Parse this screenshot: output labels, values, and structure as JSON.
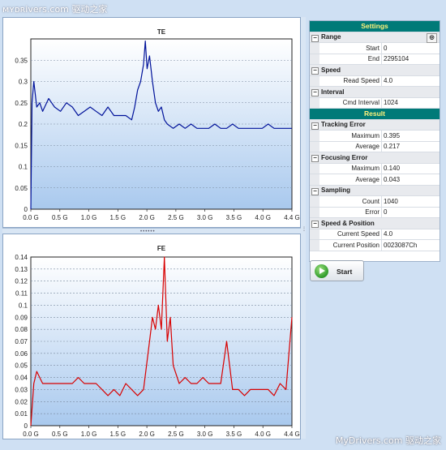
{
  "watermark": {
    "top": "ᴍʏᴅʀivers.com 驱动之家",
    "bottom": "MyDrivers.com 驱动之家"
  },
  "colors": {
    "te_line": "#00129a",
    "fe_line": "#d80000",
    "header": "#007a78",
    "header_text": "#fff27a"
  },
  "settings": {
    "title": "Settings",
    "range": {
      "label": "Range",
      "start_label": "Start",
      "start": "0",
      "end_label": "End",
      "end": "2295104"
    },
    "speed": {
      "label": "Speed",
      "read_speed_label": "Read Speed",
      "read_speed": "4.0"
    },
    "interval": {
      "label": "Interval",
      "cmd_label": "Cmd Interval",
      "cmd": "1024"
    }
  },
  "result": {
    "title": "Result",
    "tracking": {
      "label": "Tracking Error",
      "max_label": "Maximum",
      "max": "0.395",
      "avg_label": "Average",
      "avg": "0.217"
    },
    "focusing": {
      "label": "Focusing Error",
      "max_label": "Maximum",
      "max": "0.140",
      "avg_label": "Average",
      "avg": "0.043"
    },
    "sampling": {
      "label": "Sampling",
      "count_label": "Count",
      "count": "1040",
      "error_label": "Error",
      "error": "0"
    },
    "speed_position": {
      "label": "Speed & Position",
      "cur_speed_label": "Current Speed",
      "cur_speed": "4.0",
      "cur_pos_label": "Current Position",
      "cur_pos": "0023087Ch"
    }
  },
  "start_button": {
    "label": "Start"
  },
  "chart_data": [
    {
      "type": "line",
      "title": "TE",
      "xlabel": "",
      "ylabel": "",
      "xlim": [
        0,
        4.4
      ],
      "ylim": [
        0,
        0.4
      ],
      "x_ticks": [
        "0.0 G",
        "0.5 G",
        "1.0 G",
        "1.5 G",
        "2.0 G",
        "2.5 G",
        "3.0 G",
        "3.5 G",
        "4.0 G",
        "4.4 G"
      ],
      "y_ticks": [
        "0",
        "0.05",
        "0.1",
        "0.15",
        "0.2",
        "0.25",
        "0.3",
        "0.35"
      ],
      "x": [
        0,
        0.02,
        0.05,
        0.1,
        0.15,
        0.2,
        0.3,
        0.4,
        0.5,
        0.6,
        0.7,
        0.8,
        0.9,
        1.0,
        1.1,
        1.2,
        1.3,
        1.4,
        1.5,
        1.6,
        1.7,
        1.75,
        1.8,
        1.85,
        1.9,
        1.93,
        1.96,
        2.0,
        2.05,
        2.1,
        2.15,
        2.2,
        2.25,
        2.3,
        2.4,
        2.5,
        2.6,
        2.7,
        2.8,
        2.9,
        3.0,
        3.1,
        3.2,
        3.3,
        3.4,
        3.5,
        3.6,
        3.7,
        3.8,
        3.9,
        4.0,
        4.1,
        4.2,
        4.3,
        4.4
      ],
      "y": [
        0.0,
        0.25,
        0.3,
        0.24,
        0.25,
        0.23,
        0.26,
        0.24,
        0.23,
        0.25,
        0.24,
        0.22,
        0.23,
        0.24,
        0.23,
        0.22,
        0.24,
        0.22,
        0.22,
        0.22,
        0.21,
        0.24,
        0.28,
        0.3,
        0.34,
        0.395,
        0.33,
        0.36,
        0.3,
        0.25,
        0.23,
        0.24,
        0.21,
        0.2,
        0.19,
        0.2,
        0.19,
        0.2,
        0.19,
        0.19,
        0.19,
        0.2,
        0.19,
        0.19,
        0.2,
        0.19,
        0.19,
        0.19,
        0.19,
        0.19,
        0.2,
        0.19,
        0.19,
        0.19,
        0.19
      ]
    },
    {
      "type": "line",
      "title": "FE",
      "xlabel": "",
      "ylabel": "",
      "xlim": [
        0,
        4.4
      ],
      "ylim": [
        0,
        0.14
      ],
      "x_ticks": [
        "0.0 G",
        "0.5 G",
        "1.0 G",
        "1.5 G",
        "2.0 G",
        "2.5 G",
        "3.0 G",
        "3.5 G",
        "4.0 G",
        "4.4 G"
      ],
      "y_ticks": [
        "0",
        "0.01",
        "0.02",
        "0.03",
        "0.04",
        "0.05",
        "0.06",
        "0.07",
        "0.08",
        "0.09",
        "0.1",
        "0.11",
        "0.12",
        "0.13",
        "0.14"
      ],
      "x": [
        0,
        0.05,
        0.1,
        0.2,
        0.3,
        0.4,
        0.5,
        0.6,
        0.7,
        0.8,
        0.9,
        1.0,
        1.1,
        1.2,
        1.3,
        1.4,
        1.5,
        1.6,
        1.7,
        1.8,
        1.9,
        1.95,
        2.0,
        2.05,
        2.1,
        2.15,
        2.2,
        2.25,
        2.3,
        2.35,
        2.4,
        2.5,
        2.6,
        2.7,
        2.8,
        2.9,
        3.0,
        3.1,
        3.2,
        3.3,
        3.4,
        3.5,
        3.6,
        3.7,
        3.8,
        3.9,
        4.0,
        4.1,
        4.2,
        4.3,
        4.35,
        4.4
      ],
      "y": [
        0.0,
        0.035,
        0.045,
        0.035,
        0.035,
        0.035,
        0.035,
        0.035,
        0.035,
        0.04,
        0.035,
        0.035,
        0.035,
        0.03,
        0.025,
        0.03,
        0.025,
        0.035,
        0.03,
        0.025,
        0.03,
        0.05,
        0.07,
        0.09,
        0.08,
        0.1,
        0.08,
        0.14,
        0.07,
        0.09,
        0.05,
        0.035,
        0.04,
        0.035,
        0.035,
        0.04,
        0.035,
        0.035,
        0.035,
        0.07,
        0.03,
        0.03,
        0.025,
        0.03,
        0.03,
        0.03,
        0.03,
        0.025,
        0.035,
        0.03,
        0.06,
        0.09
      ]
    }
  ]
}
